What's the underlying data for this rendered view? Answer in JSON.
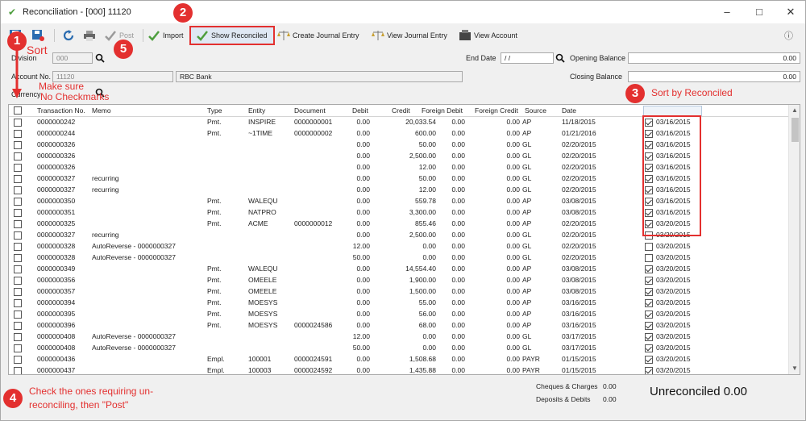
{
  "window": {
    "title": "Reconciliation - [000] 11120"
  },
  "toolbar": {
    "post_label": "Post",
    "import_label": "Import",
    "show_reconciled_label": "Show Reconciled",
    "create_journal_label": "Create Journal Entry",
    "view_journal_label": "View Journal Entry",
    "view_account_label": "View Account"
  },
  "form": {
    "division_label": "Division",
    "division_value": "000",
    "account_label": "Account No.",
    "account_value": "11120",
    "account_name": "RBC Bank",
    "currency_label": "Currency",
    "end_date_label": "End Date",
    "end_date_value": " / /",
    "opening_balance_label": "Opening Balance",
    "opening_balance_value": "0.00",
    "closing_balance_label": "Closing Balance",
    "closing_balance_value": "0.00"
  },
  "grid": {
    "columns": [
      "Transaction No.",
      "Memo",
      "Type",
      "Entity",
      "Document",
      "Debit",
      "Credit",
      "Foreign Debit",
      "Foreign Credit",
      "Source",
      "Date",
      "Reconciled"
    ],
    "rows": [
      {
        "txn": "0000000242",
        "memo": "",
        "type": "Pmt.",
        "entity": "INSPIRE",
        "doc": "0000000001",
        "debit": "0.00",
        "credit": "20,033.54",
        "fdebit": "0.00",
        "fcredit": "0.00",
        "source": "AP",
        "date": "11/18/2015",
        "rec_checked": true,
        "rec_date": "03/16/2015"
      },
      {
        "txn": "0000000244",
        "memo": "",
        "type": "Pmt.",
        "entity": "~1TIME",
        "doc": "0000000002",
        "debit": "0.00",
        "credit": "600.00",
        "fdebit": "0.00",
        "fcredit": "0.00",
        "source": "AP",
        "date": "01/21/2016",
        "rec_checked": true,
        "rec_date": "03/16/2015"
      },
      {
        "txn": "0000000326",
        "memo": "",
        "type": "",
        "entity": "",
        "doc": "",
        "debit": "0.00",
        "credit": "50.00",
        "fdebit": "0.00",
        "fcredit": "0.00",
        "source": "GL",
        "date": "02/20/2015",
        "rec_checked": true,
        "rec_date": "03/16/2015"
      },
      {
        "txn": "0000000326",
        "memo": "",
        "type": "",
        "entity": "",
        "doc": "",
        "debit": "0.00",
        "credit": "2,500.00",
        "fdebit": "0.00",
        "fcredit": "0.00",
        "source": "GL",
        "date": "02/20/2015",
        "rec_checked": true,
        "rec_date": "03/16/2015"
      },
      {
        "txn": "0000000326",
        "memo": "",
        "type": "",
        "entity": "",
        "doc": "",
        "debit": "0.00",
        "credit": "12.00",
        "fdebit": "0.00",
        "fcredit": "0.00",
        "source": "GL",
        "date": "02/20/2015",
        "rec_checked": true,
        "rec_date": "03/16/2015"
      },
      {
        "txn": "0000000327",
        "memo": "recurring",
        "type": "",
        "entity": "",
        "doc": "",
        "debit": "0.00",
        "credit": "50.00",
        "fdebit": "0.00",
        "fcredit": "0.00",
        "source": "GL",
        "date": "02/20/2015",
        "rec_checked": true,
        "rec_date": "03/16/2015"
      },
      {
        "txn": "0000000327",
        "memo": "recurring",
        "type": "",
        "entity": "",
        "doc": "",
        "debit": "0.00",
        "credit": "12.00",
        "fdebit": "0.00",
        "fcredit": "0.00",
        "source": "GL",
        "date": "02/20/2015",
        "rec_checked": true,
        "rec_date": "03/16/2015"
      },
      {
        "txn": "0000000350",
        "memo": "",
        "type": "Pmt.",
        "entity": "WALEQU",
        "doc": "",
        "debit": "0.00",
        "credit": "559.78",
        "fdebit": "0.00",
        "fcredit": "0.00",
        "source": "AP",
        "date": "03/08/2015",
        "rec_checked": true,
        "rec_date": "03/16/2015"
      },
      {
        "txn": "0000000351",
        "memo": "",
        "type": "Pmt.",
        "entity": "NATPRO",
        "doc": "",
        "debit": "0.00",
        "credit": "3,300.00",
        "fdebit": "0.00",
        "fcredit": "0.00",
        "source": "AP",
        "date": "03/08/2015",
        "rec_checked": true,
        "rec_date": "03/16/2015"
      },
      {
        "txn": "0000000325",
        "memo": "",
        "type": "Pmt.",
        "entity": "ACME",
        "doc": "0000000012",
        "debit": "0.00",
        "credit": "855.46",
        "fdebit": "0.00",
        "fcredit": "0.00",
        "source": "AP",
        "date": "02/20/2015",
        "rec_checked": true,
        "rec_date": "03/20/2015"
      },
      {
        "txn": "0000000327",
        "memo": "recurring",
        "type": "",
        "entity": "",
        "doc": "",
        "debit": "0.00",
        "credit": "2,500.00",
        "fdebit": "0.00",
        "fcredit": "0.00",
        "source": "GL",
        "date": "02/20/2015",
        "rec_checked": false,
        "rec_date": "03/20/2015"
      },
      {
        "txn": "0000000328",
        "memo": "AutoReverse - 0000000327",
        "type": "",
        "entity": "",
        "doc": "",
        "debit": "12.00",
        "credit": "0.00",
        "fdebit": "0.00",
        "fcredit": "0.00",
        "source": "GL",
        "date": "02/20/2015",
        "rec_checked": false,
        "rec_date": "03/20/2015"
      },
      {
        "txn": "0000000328",
        "memo": "AutoReverse - 0000000327",
        "type": "",
        "entity": "",
        "doc": "",
        "debit": "50.00",
        "credit": "0.00",
        "fdebit": "0.00",
        "fcredit": "0.00",
        "source": "GL",
        "date": "02/20/2015",
        "rec_checked": false,
        "rec_date": "03/20/2015"
      },
      {
        "txn": "0000000349",
        "memo": "",
        "type": "Pmt.",
        "entity": "WALEQU",
        "doc": "",
        "debit": "0.00",
        "credit": "14,554.40",
        "fdebit": "0.00",
        "fcredit": "0.00",
        "source": "AP",
        "date": "03/08/2015",
        "rec_checked": true,
        "rec_date": "03/20/2015"
      },
      {
        "txn": "0000000356",
        "memo": "",
        "type": "Pmt.",
        "entity": "OMEELE",
        "doc": "",
        "debit": "0.00",
        "credit": "1,900.00",
        "fdebit": "0.00",
        "fcredit": "0.00",
        "source": "AP",
        "date": "03/08/2015",
        "rec_checked": true,
        "rec_date": "03/20/2015"
      },
      {
        "txn": "0000000357",
        "memo": "",
        "type": "Pmt.",
        "entity": "OMEELE",
        "doc": "",
        "debit": "0.00",
        "credit": "1,500.00",
        "fdebit": "0.00",
        "fcredit": "0.00",
        "source": "AP",
        "date": "03/08/2015",
        "rec_checked": true,
        "rec_date": "03/20/2015"
      },
      {
        "txn": "0000000394",
        "memo": "",
        "type": "Pmt.",
        "entity": "MOESYS",
        "doc": "",
        "debit": "0.00",
        "credit": "55.00",
        "fdebit": "0.00",
        "fcredit": "0.00",
        "source": "AP",
        "date": "03/16/2015",
        "rec_checked": true,
        "rec_date": "03/20/2015"
      },
      {
        "txn": "0000000395",
        "memo": "",
        "type": "Pmt.",
        "entity": "MOESYS",
        "doc": "",
        "debit": "0.00",
        "credit": "56.00",
        "fdebit": "0.00",
        "fcredit": "0.00",
        "source": "AP",
        "date": "03/16/2015",
        "rec_checked": true,
        "rec_date": "03/20/2015"
      },
      {
        "txn": "0000000396",
        "memo": "",
        "type": "Pmt.",
        "entity": "MOESYS",
        "doc": "0000024586",
        "debit": "0.00",
        "credit": "68.00",
        "fdebit": "0.00",
        "fcredit": "0.00",
        "source": "AP",
        "date": "03/16/2015",
        "rec_checked": true,
        "rec_date": "03/20/2015"
      },
      {
        "txn": "0000000408",
        "memo": "AutoReverse - 0000000327",
        "type": "",
        "entity": "",
        "doc": "",
        "debit": "12.00",
        "credit": "0.00",
        "fdebit": "0.00",
        "fcredit": "0.00",
        "source": "GL",
        "date": "03/17/2015",
        "rec_checked": true,
        "rec_date": "03/20/2015"
      },
      {
        "txn": "0000000408",
        "memo": "AutoReverse - 0000000327",
        "type": "",
        "entity": "",
        "doc": "",
        "debit": "50.00",
        "credit": "0.00",
        "fdebit": "0.00",
        "fcredit": "0.00",
        "source": "GL",
        "date": "03/17/2015",
        "rec_checked": true,
        "rec_date": "03/20/2015"
      },
      {
        "txn": "0000000436",
        "memo": "",
        "type": "Empl.",
        "entity": "100001",
        "doc": "0000024591",
        "debit": "0.00",
        "credit": "1,508.68",
        "fdebit": "0.00",
        "fcredit": "0.00",
        "source": "PAYR",
        "date": "01/15/2015",
        "rec_checked": true,
        "rec_date": "03/20/2015"
      },
      {
        "txn": "0000000437",
        "memo": "",
        "type": "Empl.",
        "entity": "100003",
        "doc": "0000024592",
        "debit": "0.00",
        "credit": "1,435.88",
        "fdebit": "0.00",
        "fcredit": "0.00",
        "source": "PAYR",
        "date": "01/15/2015",
        "rec_checked": true,
        "rec_date": "03/20/2015"
      }
    ]
  },
  "footer": {
    "cheques_label": "Cheques & Charges",
    "cheques_value": "0.00",
    "deposits_label": "Deposits & Debits",
    "deposits_value": "0.00",
    "unreconciled_text": "Unreconciled 0.00"
  },
  "annotations": {
    "n1": "1",
    "n2": "2",
    "n3": "3",
    "n4": "4",
    "n5": "5",
    "sort": "Sort",
    "make_sure": "Make sure",
    "no_checkmarks": "No Checkmarks",
    "sort_by_reconciled": "Sort by Reconciled",
    "check_line1": "Check the ones requiring un-",
    "check_line2": "reconciling, then \"Post\""
  },
  "colors": {
    "annotation": "#e3302f",
    "title_check": "#4d9e3d",
    "toolbar_blue": "#2b6cb0"
  }
}
